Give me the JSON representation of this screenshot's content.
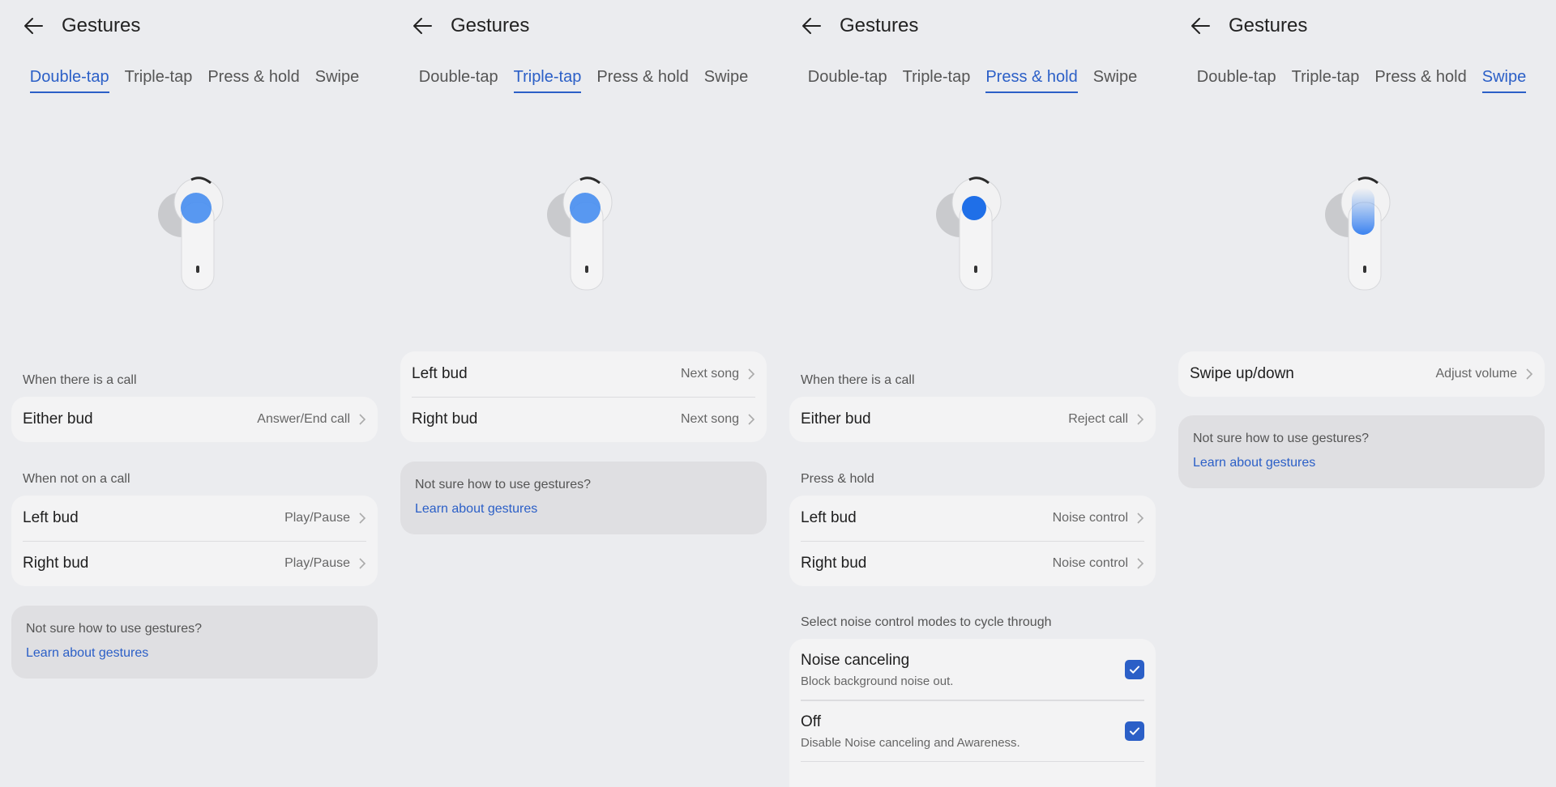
{
  "colors": {
    "accent": "#2b5fc7",
    "background": "#ebecef",
    "card": "#f3f3f4",
    "help_card": "#dfdfe2"
  },
  "icons": {
    "back": "arrow-left-icon",
    "chevron": "chevron-right-icon",
    "check": "checkmark-icon"
  },
  "panels": [
    {
      "title": "Gestures",
      "tabs": [
        "Double-tap",
        "Triple-tap",
        "Press & hold",
        "Swipe"
      ],
      "active_tab": "Double-tap",
      "sections": [
        {
          "label": "When there is a call",
          "rows": [
            {
              "label": "Either bud",
              "value": "Answer/End call"
            }
          ]
        },
        {
          "label": "When not on a call",
          "rows": [
            {
              "label": "Left bud",
              "value": "Play/Pause"
            },
            {
              "label": "Right bud",
              "value": "Play/Pause"
            }
          ]
        }
      ],
      "help": {
        "text": "Not sure how to use gestures?",
        "link": "Learn about gestures"
      }
    },
    {
      "title": "Gestures",
      "tabs": [
        "Double-tap",
        "Triple-tap",
        "Press & hold",
        "Swipe"
      ],
      "active_tab": "Triple-tap",
      "rows": [
        {
          "label": "Left bud",
          "value": "Next song"
        },
        {
          "label": "Right bud",
          "value": "Next song"
        }
      ],
      "help": {
        "text": "Not sure how to use gestures?",
        "link": "Learn about gestures"
      }
    },
    {
      "title": "Gestures",
      "tabs": [
        "Double-tap",
        "Triple-tap",
        "Press & hold",
        "Swipe"
      ],
      "active_tab": "Press & hold",
      "sections": [
        {
          "label": "When there is a call",
          "rows": [
            {
              "label": "Either bud",
              "value": "Reject call"
            }
          ]
        },
        {
          "label": "Press & hold",
          "rows": [
            {
              "label": "Left bud",
              "value": "Noise control"
            },
            {
              "label": "Right bud",
              "value": "Noise control"
            }
          ]
        }
      ],
      "cycle_label": "Select noise control modes to cycle through",
      "modes": [
        {
          "title": "Noise canceling",
          "desc": "Block background noise out.",
          "checked": true
        },
        {
          "title": "Off",
          "desc": "Disable Noise canceling and Awareness.",
          "checked": true
        }
      ]
    },
    {
      "title": "Gestures",
      "tabs": [
        "Double-tap",
        "Triple-tap",
        "Press & hold",
        "Swipe"
      ],
      "active_tab": "Swipe",
      "rows": [
        {
          "label": "Swipe up/down",
          "value": "Adjust volume"
        }
      ],
      "help": {
        "text": "Not sure how to use gestures?",
        "link": "Learn about gestures"
      }
    }
  ]
}
